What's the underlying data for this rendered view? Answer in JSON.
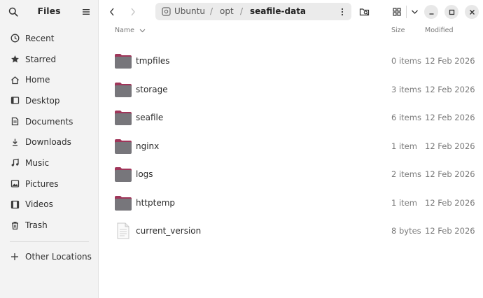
{
  "sidebar": {
    "title": "Files",
    "items": [
      {
        "label": "Recent",
        "icon": "clock-icon"
      },
      {
        "label": "Starred",
        "icon": "star-icon"
      },
      {
        "label": "Home",
        "icon": "home-icon"
      },
      {
        "label": "Desktop",
        "icon": "desktop-icon"
      },
      {
        "label": "Documents",
        "icon": "documents-icon"
      },
      {
        "label": "Downloads",
        "icon": "download-icon"
      },
      {
        "label": "Music",
        "icon": "music-icon"
      },
      {
        "label": "Pictures",
        "icon": "pictures-icon"
      },
      {
        "label": "Videos",
        "icon": "videos-icon"
      },
      {
        "label": "Trash",
        "icon": "trash-icon"
      }
    ],
    "other_locations": "Other Locations"
  },
  "pathbar": {
    "segments": [
      "Ubuntu",
      "opt",
      "seafile-data"
    ],
    "separator": "/"
  },
  "columns": {
    "name": "Name",
    "size": "Size",
    "modified": "Modified"
  },
  "files": [
    {
      "name": "tmpfiles",
      "size": "0 items",
      "modified": "12 Feb 2026",
      "type": "folder"
    },
    {
      "name": "storage",
      "size": "3 items",
      "modified": "12 Feb 2026",
      "type": "folder"
    },
    {
      "name": "seafile",
      "size": "6 items",
      "modified": "12 Feb 2026",
      "type": "folder"
    },
    {
      "name": "nginx",
      "size": "1 item",
      "modified": "12 Feb 2026",
      "type": "folder"
    },
    {
      "name": "logs",
      "size": "2 items",
      "modified": "12 Feb 2026",
      "type": "folder"
    },
    {
      "name": "httptemp",
      "size": "1 item",
      "modified": "12 Feb 2026",
      "type": "folder"
    },
    {
      "name": "current_version",
      "size": "8 bytes",
      "modified": "12 Feb 2026",
      "type": "file"
    }
  ],
  "colors": {
    "folder_body": "#77767b",
    "folder_tab": "#a0365a",
    "sidebar_bg": "#f3f3f3",
    "pathbar_bg": "#ebebeb"
  }
}
